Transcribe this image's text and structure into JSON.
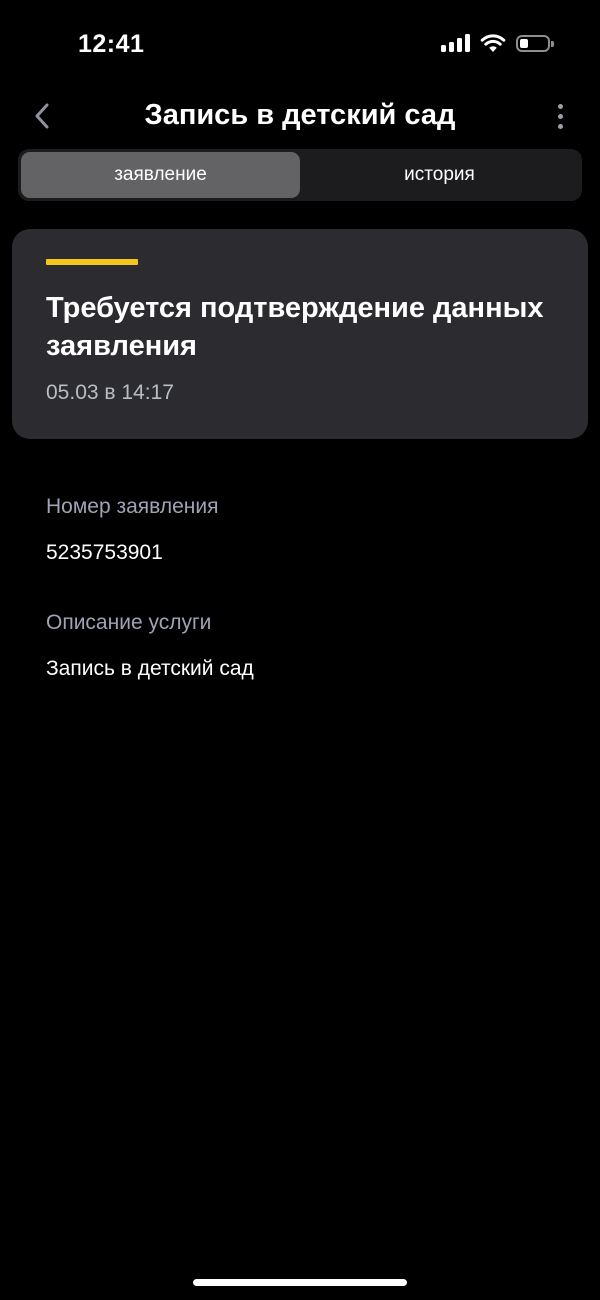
{
  "status_bar": {
    "time": "12:41",
    "signal_icon": "cellular-signal-icon",
    "wifi_icon": "wifi-icon",
    "battery_icon": "battery-icon",
    "battery_level": 0.3
  },
  "nav": {
    "back_icon": "chevron-left-icon",
    "title": "Запись в детский сад",
    "more_icon": "more-vertical-icon"
  },
  "tabs": [
    {
      "label": "заявление",
      "active": true
    },
    {
      "label": "история",
      "active": false
    }
  ],
  "status_card": {
    "title": "Требуется подтверждение данных заявления",
    "date": "05.03 в 14:17",
    "accent_color": "#f5c518"
  },
  "details": {
    "application_number_label": "Номер заявления",
    "application_number": "5235753901",
    "service_description_label": "Описание услуги",
    "service_description": "Запись в детский сад"
  },
  "colors": {
    "background": "#000000",
    "card": "#2c2c30",
    "label": "#9ea3b5",
    "accent": "#f5c518"
  }
}
